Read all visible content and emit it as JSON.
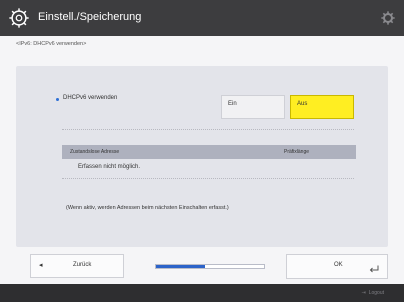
{
  "window": {
    "title": "Einstell./Speicherung",
    "app_icon": "gear-wrench-icon",
    "corner_icon": "gear-icon"
  },
  "breadcrumb": "<IPv6: DHCPv6 verwenden>",
  "option": {
    "label": "DHCPv6 verwenden",
    "on_label": "Ein",
    "off_label": "Aus",
    "selected": "Aus"
  },
  "table": {
    "headers": [
      "Zustandslose Adresse",
      "Präfixlänge"
    ],
    "rows": [
      "Erfassen nicht möglich."
    ]
  },
  "note": "(Wenn aktiv, werden Adressen beim nächsten Einschalten erfasst.)",
  "bottom": {
    "back_label": "Zurück",
    "ok_label": "OK",
    "progress": 0.45
  },
  "footer": {
    "logout_label": "Logout"
  },
  "colors": {
    "titlebar": "#3d3d3f",
    "selected": "#ffee22",
    "accent": "#2c63c9"
  }
}
